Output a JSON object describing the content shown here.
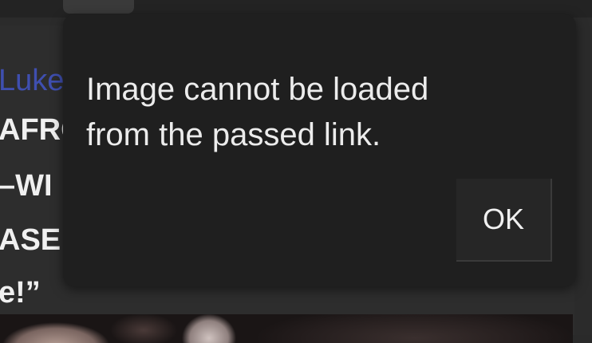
{
  "background_page": {
    "author_fragment": "Luke",
    "headline_fragments": [
      "AFRO",
      "–WI",
      "ASE",
      "e!”"
    ]
  },
  "dialog": {
    "message_line_1": "Image cannot be loaded",
    "message_line_2": "from the passed link.",
    "ok_label": "OK"
  },
  "colors": {
    "dialog_background": "#1f1f1f",
    "dialog_text": "#ececec",
    "link_blue": "#3f4fb0",
    "headline_text": "#f0f0f0"
  }
}
